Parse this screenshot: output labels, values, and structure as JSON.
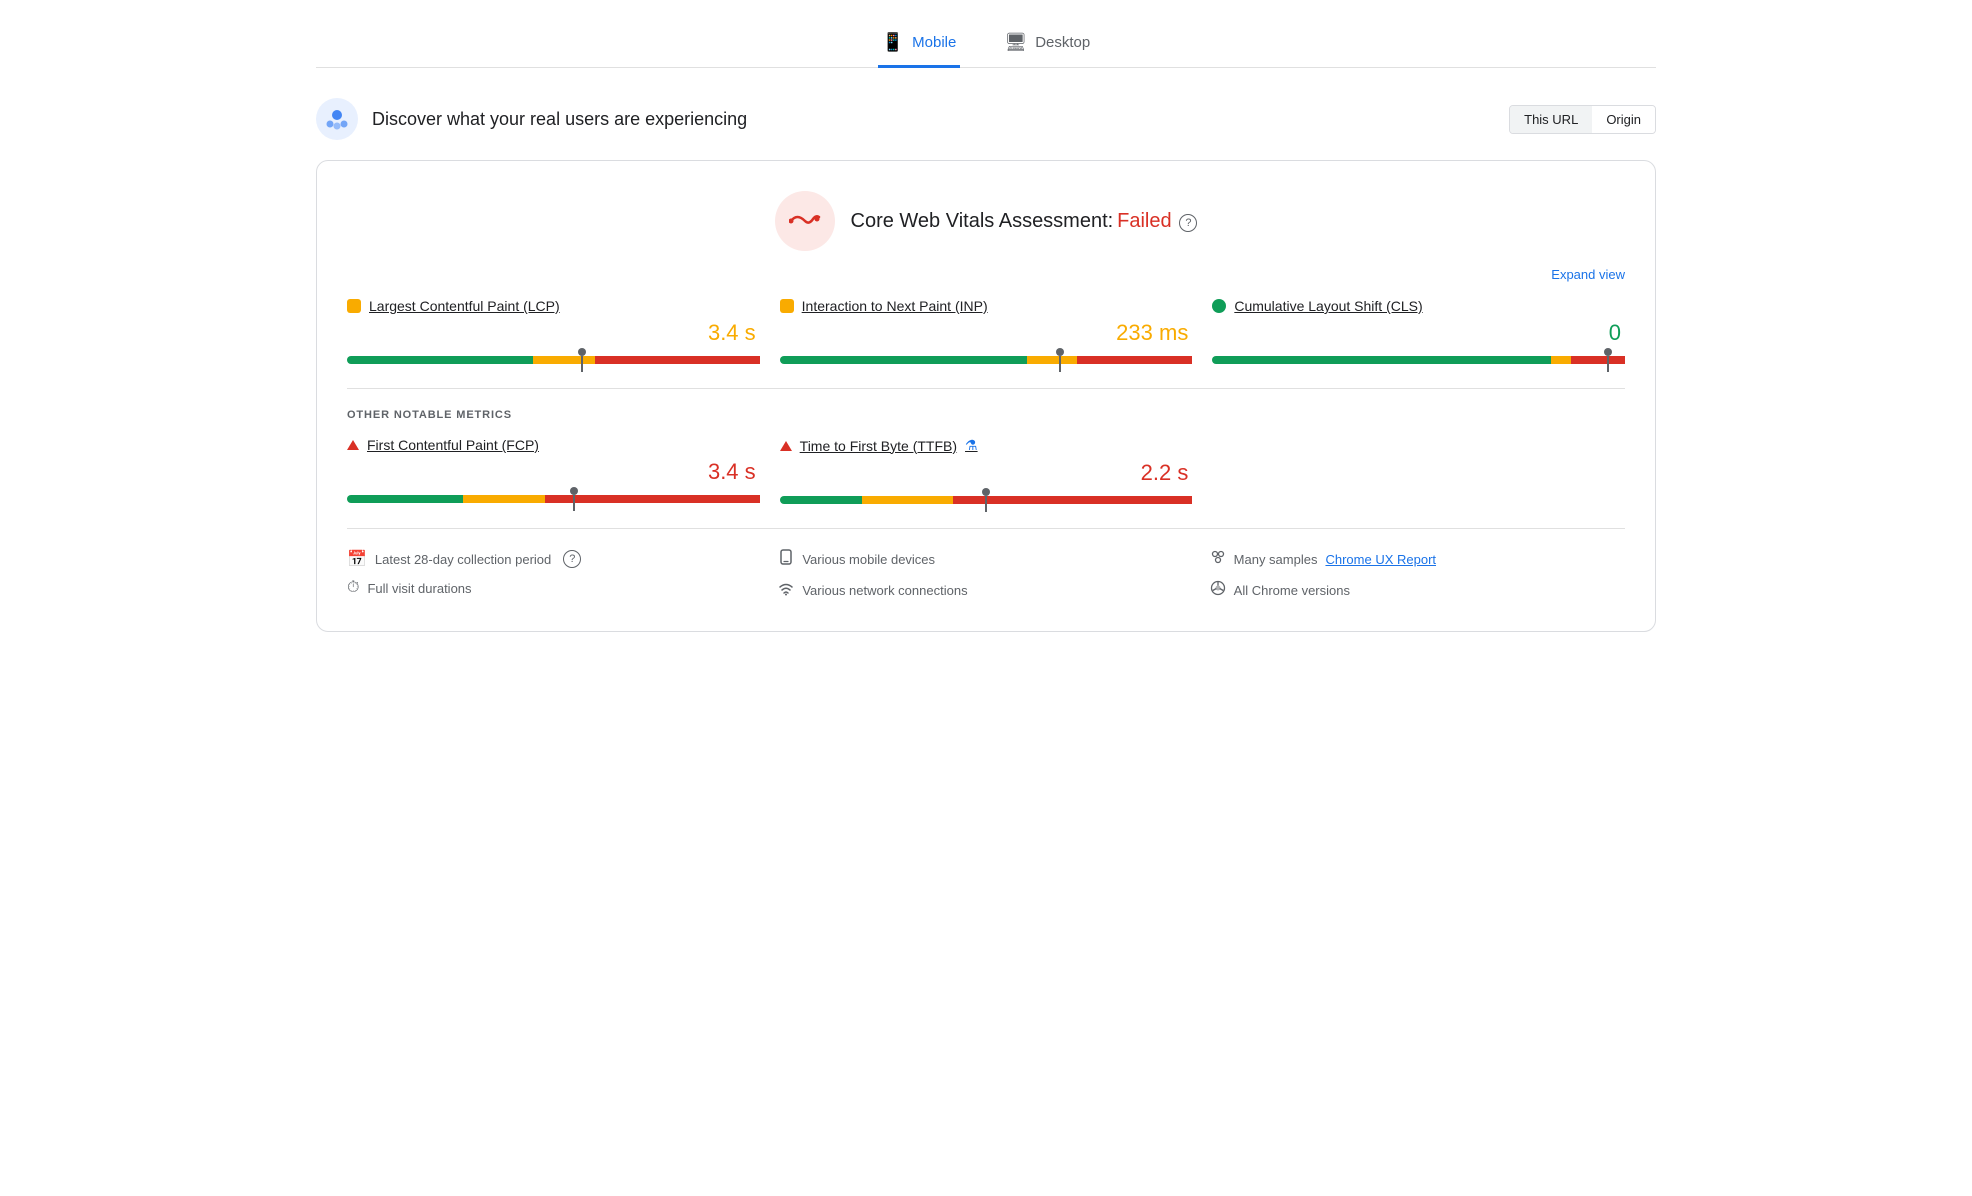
{
  "tabs": [
    {
      "id": "mobile",
      "label": "Mobile",
      "icon": "📱",
      "active": true
    },
    {
      "id": "desktop",
      "label": "Desktop",
      "icon": "🖥",
      "active": false
    }
  ],
  "header": {
    "title": "Discover what your real users are experiencing",
    "url_toggle": {
      "this_url_label": "This URL",
      "origin_label": "Origin"
    }
  },
  "assessment": {
    "title_prefix": "Core Web Vitals Assessment:",
    "status": "Failed",
    "expand_label": "Expand view"
  },
  "metrics_top": [
    {
      "id": "lcp",
      "label": "Largest Contentful Paint (LCP)",
      "dot_type": "orange-square",
      "value": "3.4 s",
      "value_color": "orange",
      "bar": {
        "green": 45,
        "orange": 15,
        "red": 40,
        "needle_pct": 57
      }
    },
    {
      "id": "inp",
      "label": "Interaction to Next Paint (INP)",
      "dot_type": "orange-square",
      "value": "233 ms",
      "value_color": "orange",
      "bar": {
        "green": 60,
        "orange": 12,
        "red": 28,
        "needle_pct": 68
      }
    },
    {
      "id": "cls",
      "label": "Cumulative Layout Shift (CLS)",
      "dot_type": "green-circle",
      "value": "0",
      "value_color": "green",
      "bar": {
        "green": 82,
        "orange": 5,
        "red": 13,
        "needle_pct": 96
      }
    }
  ],
  "other_metrics_label": "OTHER NOTABLE METRICS",
  "metrics_bottom": [
    {
      "id": "fcp",
      "label": "First Contentful Paint (FCP)",
      "icon_type": "triangle",
      "value": "3.4 s",
      "value_color": "red",
      "bar": {
        "green": 28,
        "orange": 20,
        "red": 52,
        "needle_pct": 55
      }
    },
    {
      "id": "ttfb",
      "label": "Time to First Byte (TTFB)",
      "icon_type": "triangle",
      "has_flask": true,
      "value": "2.2 s",
      "value_color": "red",
      "bar": {
        "green": 20,
        "orange": 22,
        "red": 58,
        "needle_pct": 50
      }
    },
    {
      "id": "empty",
      "label": "",
      "empty": true
    }
  ],
  "footer": {
    "col1": [
      {
        "icon": "📅",
        "text": "Latest 28-day collection period",
        "has_help": true
      },
      {
        "icon": "⏱",
        "text": "Full visit durations"
      }
    ],
    "col2": [
      {
        "icon": "📱",
        "text": "Various mobile devices"
      },
      {
        "icon": "📶",
        "text": "Various network connections"
      }
    ],
    "col3": [
      {
        "icon": "🔵",
        "text_before": "Many samples ",
        "link_text": "Chrome UX Report",
        "text_after": ""
      },
      {
        "icon": "⚙",
        "text": "All Chrome versions"
      }
    ]
  }
}
